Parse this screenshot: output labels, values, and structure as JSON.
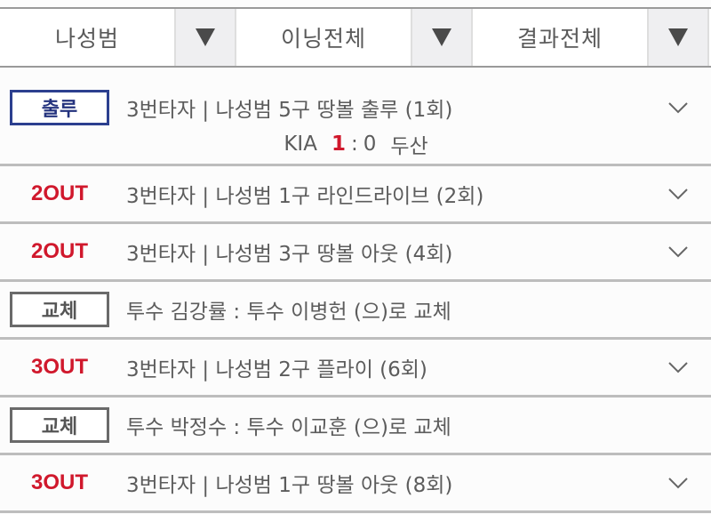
{
  "filters": [
    {
      "label": "나성범",
      "arrow_icon": "triangle-down"
    },
    {
      "label": "이닝전체",
      "arrow_icon": "triangle-down"
    },
    {
      "label": "결과전체",
      "arrow_icon": "triangle-down"
    }
  ],
  "colors": {
    "out_red": "#d0182c",
    "onbase_blue": "#24337e",
    "sub_gray": "#555555",
    "divider": "#bdbdbd"
  },
  "rows": [
    {
      "badge": "출루",
      "badge_style": "boxed-blue",
      "text": "3번타자 | 나성범 5구 땅볼 출루 (1회)",
      "expandable": true,
      "score": {
        "home_team": "KIA",
        "home_score": "1",
        "separator": ":",
        "away_score": "0",
        "away_team": "두산"
      }
    },
    {
      "badge": "2OUT",
      "badge_style": "out",
      "text": "3번타자 | 나성범 1구 라인드라이브 (2회)",
      "expandable": true
    },
    {
      "badge": "2OUT",
      "badge_style": "out",
      "text": "3번타자 | 나성범 3구 땅볼 아웃 (4회)",
      "expandable": true
    },
    {
      "badge": "교체",
      "badge_style": "boxed-gray",
      "text": "투수 김강률 : 투수 이병헌 (으)로 교체",
      "expandable": false
    },
    {
      "badge": "3OUT",
      "badge_style": "out",
      "text": "3번타자 | 나성범 2구 플라이 (6회)",
      "expandable": true
    },
    {
      "badge": "교체",
      "badge_style": "boxed-gray",
      "text": "투수 박정수 : 투수 이교훈 (으)로 교체",
      "expandable": false
    },
    {
      "badge": "3OUT",
      "badge_style": "out",
      "text": "3번타자 | 나성범 1구 땅볼 아웃 (8회)",
      "expandable": true
    }
  ]
}
